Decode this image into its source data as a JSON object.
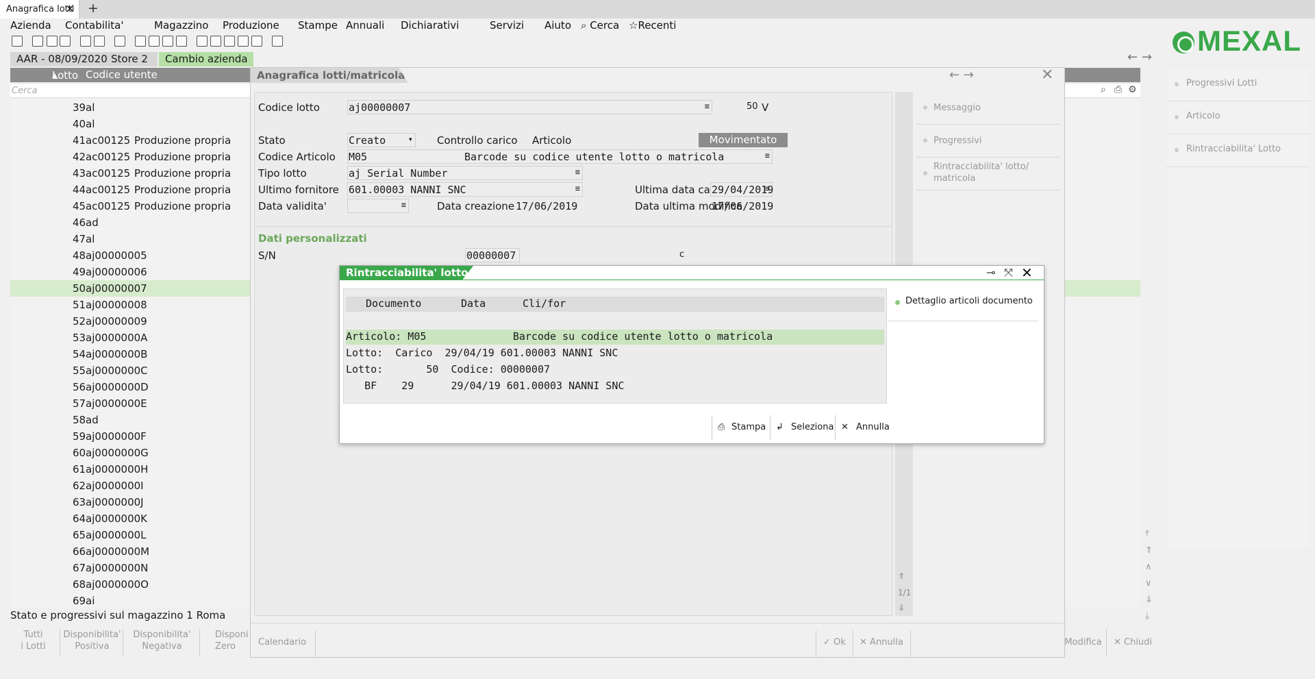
{
  "tab": {
    "title": "Anagrafica lotti",
    "close": "✕",
    "add": "+"
  },
  "menu": {
    "items": [
      "Azienda",
      "Contabilita'",
      "Magazzino",
      "Produzione",
      "Stampe",
      "Annuali",
      "Dichiarativi",
      "Servizi",
      "Aiuto"
    ],
    "search": "Cerca",
    "recent": "Recenti"
  },
  "company": {
    "info": "AAR - 08/09/2020",
    "store": "Store 2",
    "change": "Cambio azienda"
  },
  "logo": {
    "text": "MEXAL",
    "color": "#3aa84a"
  },
  "list": {
    "columns": [
      "Lotto",
      "Codice utente"
    ],
    "search_placeholder": "Cerca",
    "rows": [
      {
        "n": "39",
        "code": "al",
        "user": ""
      },
      {
        "n": "40",
        "code": "al",
        "user": ""
      },
      {
        "n": "41",
        "code": "ac00125",
        "user": "Produzione propria"
      },
      {
        "n": "42",
        "code": "ac00125",
        "user": "Produzione propria"
      },
      {
        "n": "43",
        "code": "ac00125",
        "user": "Produzione propria"
      },
      {
        "n": "44",
        "code": "ac00125",
        "user": "Produzione propria"
      },
      {
        "n": "45",
        "code": "ac00125",
        "user": "Produzione propria"
      },
      {
        "n": "46",
        "code": "ad",
        "user": ""
      },
      {
        "n": "47",
        "code": "al",
        "user": ""
      },
      {
        "n": "48",
        "code": "aj00000005",
        "user": ""
      },
      {
        "n": "49",
        "code": "aj00000006",
        "user": ""
      },
      {
        "n": "50",
        "code": "aj00000007",
        "user": ""
      },
      {
        "n": "51",
        "code": "aj00000008",
        "user": ""
      },
      {
        "n": "52",
        "code": "aj00000009",
        "user": ""
      },
      {
        "n": "53",
        "code": "aj0000000A",
        "user": ""
      },
      {
        "n": "54",
        "code": "aj0000000B",
        "user": ""
      },
      {
        "n": "55",
        "code": "aj0000000C",
        "user": ""
      },
      {
        "n": "56",
        "code": "aj0000000D",
        "user": ""
      },
      {
        "n": "57",
        "code": "aj0000000E",
        "user": ""
      },
      {
        "n": "58",
        "code": "ad",
        "user": ""
      },
      {
        "n": "59",
        "code": "aj0000000F",
        "user": ""
      },
      {
        "n": "60",
        "code": "aj0000000G",
        "user": ""
      },
      {
        "n": "61",
        "code": "aj0000000H",
        "user": ""
      },
      {
        "n": "62",
        "code": "aj0000000I",
        "user": ""
      },
      {
        "n": "63",
        "code": "aj0000000J",
        "user": ""
      },
      {
        "n": "64",
        "code": "aj0000000K",
        "user": ""
      },
      {
        "n": "65",
        "code": "aj0000000L",
        "user": ""
      },
      {
        "n": "66",
        "code": "aj0000000M",
        "user": ""
      },
      {
        "n": "67",
        "code": "aj0000000N",
        "user": ""
      },
      {
        "n": "68",
        "code": "aj0000000O",
        "user": ""
      },
      {
        "n": "69",
        "code": "ai",
        "user": ""
      }
    ],
    "status": "Stato e progressivi sul magazzino 1 Roma"
  },
  "side": {
    "items": [
      "Progressivi Lotti",
      "Articolo",
      "Rintracciabilita' Lotto"
    ]
  },
  "bottom": {
    "tutti": "Tutti",
    "tutti2": "i Lotti",
    "disp_pos": "Disponibilita'",
    "disp_pos2": "Positiva",
    "disp_neg": "Disponibilita'",
    "disp_neg2": "Negativa",
    "disp_zero": "Disponi",
    "disp_zero2": "Zero",
    "modifica": "Modifica",
    "chiudi": "Chiudi"
  },
  "ana": {
    "title": "Anagrafica lotti/matricola",
    "codice_lotto_label": "Codice lotto",
    "codice_lotto": "aj00000007",
    "num": "50",
    "v": "V",
    "stato_label": "Stato",
    "stato": "Creato",
    "controllo_carico": "Controllo carico",
    "articolo_label": "Articolo",
    "movimentato": "Movimentato",
    "codice_articolo_label": "Codice Articolo",
    "codice_articolo": "M05",
    "descr_articolo": "Barcode su codice utente lotto o matricola",
    "tipo_lotto_label": "Tipo lotto",
    "tipo_lotto": "aj Serial Number",
    "ultimo_fornitore_label": "Ultimo fornitore",
    "ultimo_fornitore": "601.00003 NANNI SNC",
    "ultima_data_carico_label": "Ultima data carico",
    "ultima_data_carico": "29/04/2019",
    "data_validita_label": "Data validita'",
    "data_creazione_label": "Data creazione",
    "data_creazione": "17/06/2019",
    "data_ultima_modifica_label": "Data ultima modifica",
    "data_ultima_modifica": "17/06/2019",
    "dati_personalizzati": "Dati personalizzati",
    "sn_label": "S/N",
    "sn_value": "00000007",
    "c": "c",
    "page": "1/1",
    "side_items": [
      "Messaggio",
      "Progressivi",
      "Rintracciabilita' lotto/",
      "matricola"
    ],
    "calendario": "Calendario",
    "ok": "Ok",
    "annulla": "Annulla"
  },
  "dlg": {
    "title": "Rintracciabilita' lotto",
    "head_documento": "Documento",
    "head_data": "Data",
    "head_clifor": "Cli/for",
    "lines": [
      "Articolo: M05              Barcode su codice utente lotto o matricola",
      "Lotto:  Carico  29/04/19 601.00003 NANNI SNC",
      "Lotto:       50  Codice: 00000007",
      "   BF    29      29/04/19 601.00003 NANNI SNC"
    ],
    "side": "Dettaglio articoli documento",
    "stampa": "Stampa",
    "seleziona": "Seleziona",
    "annulla": "Annulla"
  }
}
